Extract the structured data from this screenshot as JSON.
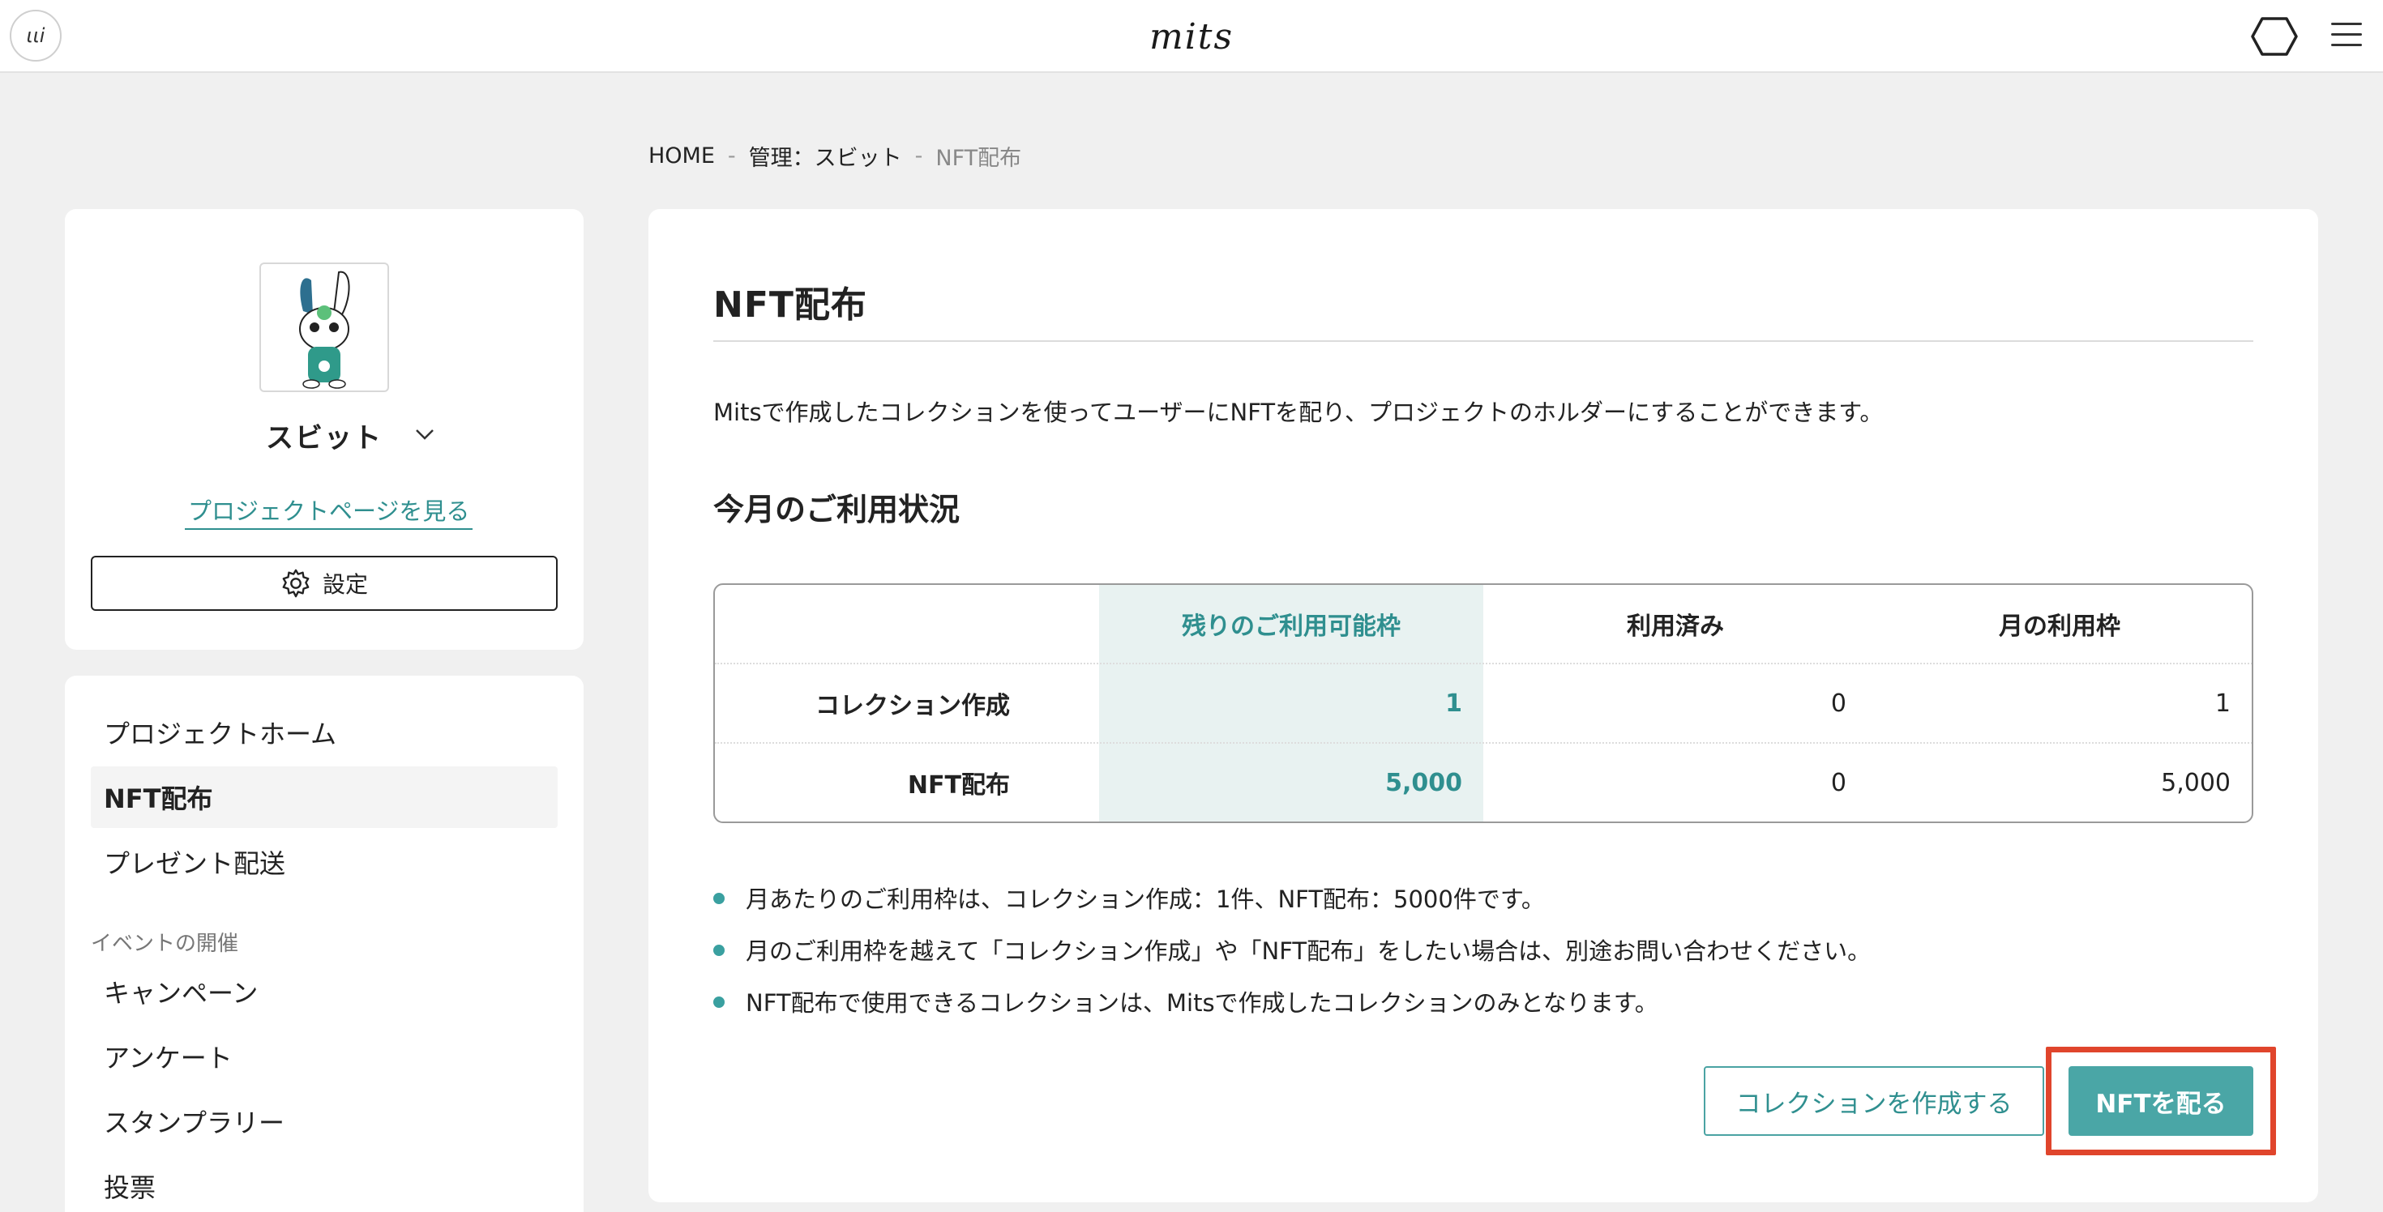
{
  "header": {
    "user_logo_text": "ιιi",
    "brand": "mits"
  },
  "breadcrumb": {
    "home": "HOME",
    "manage": "管理：スビット",
    "current": "NFT配布",
    "separator": "-"
  },
  "profile": {
    "name": "スビット",
    "project_link": "プロジェクトページを見る",
    "settings_label": "設定"
  },
  "nav": {
    "project_home": "プロジェクトホーム",
    "nft_distribution": "NFT配布",
    "present_delivery": "プレゼント配送",
    "events_section": "イベントの開催",
    "campaign": "キャンペーン",
    "survey": "アンケート",
    "stamp_rally": "スタンプラリー",
    "vote": "投票"
  },
  "main": {
    "title": "NFT配布",
    "description": "Mitsで作成したコレクションを使ってユーザーにNFTを配り、プロジェクトのホルダーにすることができます。",
    "usage_title": "今月のご利用状況",
    "table": {
      "headers": [
        "",
        "残りのご利用可能枠",
        "利用済み",
        "月の利用枠"
      ],
      "rows": [
        {
          "label": "コレクション作成",
          "remaining": "1",
          "used": "0",
          "limit": "1"
        },
        {
          "label": "NFT配布",
          "remaining": "5,000",
          "used": "0",
          "limit": "5,000"
        }
      ]
    },
    "notes": [
      "月あたりのご利用枠は、コレクション作成：1件、NFT配布：5000件です。",
      "月のご利用枠を越えて「コレクション作成」や「NFT配布」をしたい場合は、別途お問い合わせください。",
      "NFT配布で使用できるコレクションは、Mitsで作成したコレクションのみとなります。"
    ],
    "create_collection_label": "コレクションを作成する",
    "distribute_label": "NFTを配る"
  },
  "colors": {
    "accent": "#4aa6a6",
    "accent_text": "#2f8f8f",
    "highlight": "#e0452c",
    "background": "#f0f0f0"
  }
}
